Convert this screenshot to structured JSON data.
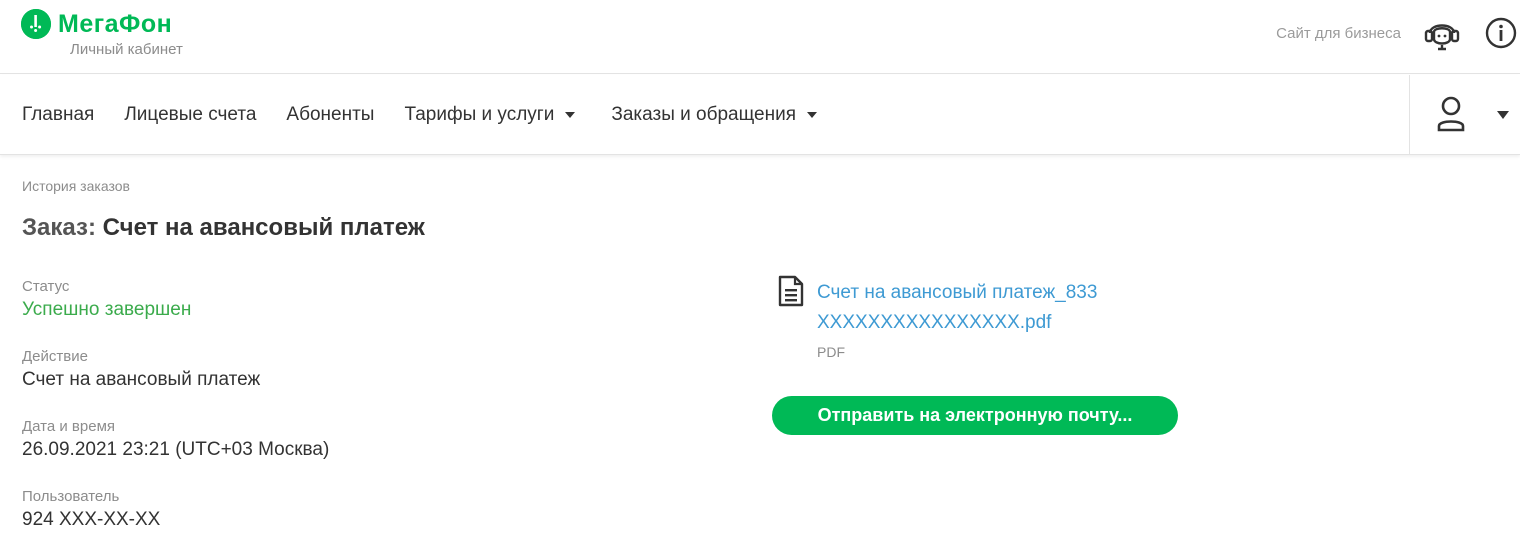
{
  "brand": {
    "name": "МегаФон",
    "subtitle": "Личный кабинет",
    "color": "#00b956"
  },
  "header": {
    "business_link": "Сайт для бизнеса",
    "icons": [
      "support-headset-icon",
      "info-icon"
    ]
  },
  "nav": {
    "items": [
      {
        "label": "Главная",
        "has_dropdown": false
      },
      {
        "label": "Лицевые счета",
        "has_dropdown": false
      },
      {
        "label": "Абоненты",
        "has_dropdown": false
      },
      {
        "label": "Тарифы и услуги",
        "has_dropdown": true
      },
      {
        "label": "Заказы и обращения",
        "has_dropdown": true
      }
    ],
    "account_icon": "user-icon"
  },
  "breadcrumb": "История заказов",
  "order": {
    "title_prefix": "Заказ:",
    "title": "Счет на авансовый платеж",
    "fields": [
      {
        "label": "Статус",
        "value": "Успешно завершен",
        "status_color": "#3bab4c"
      },
      {
        "label": "Действие",
        "value": "Счет на авансовый платеж"
      },
      {
        "label": "Дата и время",
        "value": "26.09.2021 23:21 (UTC+03 Москва)"
      },
      {
        "label": "Пользователь",
        "value": "924 XXX-XX-XX"
      }
    ]
  },
  "document": {
    "icon": "document-icon",
    "file_name": "Счет на авансовый платеж_833 XXXXXXXXXXXXXXXX.pdf",
    "file_type": "PDF",
    "link_color": "#3e9ad3"
  },
  "actions": {
    "send_email": "Отправить на электронную почту..."
  }
}
